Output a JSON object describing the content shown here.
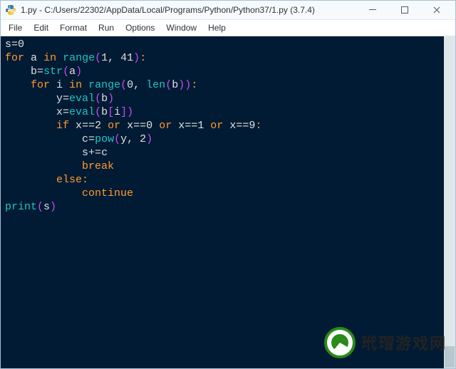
{
  "window": {
    "title": "1.py - C:/Users/22302/AppData/Local/Programs/Python/Python37/1.py (3.7.4)"
  },
  "menu": {
    "items": [
      "File",
      "Edit",
      "Format",
      "Run",
      "Options",
      "Window",
      "Help"
    ]
  },
  "code": {
    "lines": [
      [
        [
          "id",
          "s"
        ],
        [
          "op",
          "="
        ],
        [
          "num",
          "0"
        ]
      ],
      [
        [
          "kw",
          "for"
        ],
        [
          "sp",
          " "
        ],
        [
          "id",
          "a"
        ],
        [
          "sp",
          " "
        ],
        [
          "kw",
          "in"
        ],
        [
          "sp",
          " "
        ],
        [
          "fn",
          "range"
        ],
        [
          "br",
          "("
        ],
        [
          "num",
          "1"
        ],
        [
          "op",
          ", "
        ],
        [
          "num",
          "41"
        ],
        [
          "br",
          ")"
        ],
        [
          "col",
          ":"
        ]
      ],
      [
        [
          "indent",
          "    "
        ],
        [
          "id",
          "b"
        ],
        [
          "op",
          "="
        ],
        [
          "fn",
          "str"
        ],
        [
          "br",
          "("
        ],
        [
          "id",
          "a"
        ],
        [
          "br",
          ")"
        ]
      ],
      [
        [
          "indent",
          "    "
        ],
        [
          "kw",
          "for"
        ],
        [
          "sp",
          " "
        ],
        [
          "id",
          "i"
        ],
        [
          "sp",
          " "
        ],
        [
          "kw",
          "in"
        ],
        [
          "sp",
          " "
        ],
        [
          "fn",
          "range"
        ],
        [
          "br",
          "("
        ],
        [
          "num",
          "0"
        ],
        [
          "op",
          ", "
        ],
        [
          "fn",
          "len"
        ],
        [
          "br",
          "("
        ],
        [
          "id",
          "b"
        ],
        [
          "br",
          ")"
        ],
        [
          "br",
          ")"
        ],
        [
          "col",
          ":"
        ]
      ],
      [
        [
          "indent",
          "        "
        ],
        [
          "id",
          "y"
        ],
        [
          "op",
          "="
        ],
        [
          "fn",
          "eval"
        ],
        [
          "br",
          "("
        ],
        [
          "id",
          "b"
        ],
        [
          "br",
          ")"
        ]
      ],
      [
        [
          "indent",
          "        "
        ],
        [
          "id",
          "x"
        ],
        [
          "op",
          "="
        ],
        [
          "fn",
          "eval"
        ],
        [
          "br",
          "("
        ],
        [
          "id",
          "b"
        ],
        [
          "br",
          "["
        ],
        [
          "id",
          "i"
        ],
        [
          "br",
          "]"
        ],
        [
          "br",
          ")"
        ]
      ],
      [
        [
          "indent",
          "        "
        ],
        [
          "kw",
          "if"
        ],
        [
          "sp",
          " "
        ],
        [
          "id",
          "x"
        ],
        [
          "op",
          "=="
        ],
        [
          "num",
          "2"
        ],
        [
          "sp",
          " "
        ],
        [
          "kw",
          "or"
        ],
        [
          "sp",
          " "
        ],
        [
          "id",
          "x"
        ],
        [
          "op",
          "=="
        ],
        [
          "num",
          "0"
        ],
        [
          "sp",
          " "
        ],
        [
          "kw",
          "or"
        ],
        [
          "sp",
          " "
        ],
        [
          "id",
          "x"
        ],
        [
          "op",
          "=="
        ],
        [
          "num",
          "1"
        ],
        [
          "sp",
          " "
        ],
        [
          "kw",
          "or"
        ],
        [
          "sp",
          " "
        ],
        [
          "id",
          "x"
        ],
        [
          "op",
          "=="
        ],
        [
          "num",
          "9"
        ],
        [
          "col",
          ":"
        ]
      ],
      [
        [
          "indent",
          "            "
        ],
        [
          "id",
          "c"
        ],
        [
          "op",
          "="
        ],
        [
          "fn",
          "pow"
        ],
        [
          "br",
          "("
        ],
        [
          "id",
          "y"
        ],
        [
          "op",
          ", "
        ],
        [
          "num",
          "2"
        ],
        [
          "br",
          ")"
        ]
      ],
      [
        [
          "indent",
          "            "
        ],
        [
          "id",
          "s"
        ],
        [
          "op",
          "+="
        ],
        [
          "id",
          "c"
        ]
      ],
      [
        [
          "indent",
          "            "
        ],
        [
          "kw",
          "break"
        ]
      ],
      [
        [
          "indent",
          "        "
        ],
        [
          "kw",
          "else"
        ],
        [
          "col",
          ":"
        ]
      ],
      [
        [
          "indent",
          "            "
        ],
        [
          "kw",
          "continue"
        ]
      ],
      [
        [
          "fn",
          "print"
        ],
        [
          "br",
          "("
        ],
        [
          "id",
          "s"
        ],
        [
          "br",
          ")"
        ]
      ]
    ]
  },
  "watermark": {
    "text": "玳瑁游戏网"
  }
}
